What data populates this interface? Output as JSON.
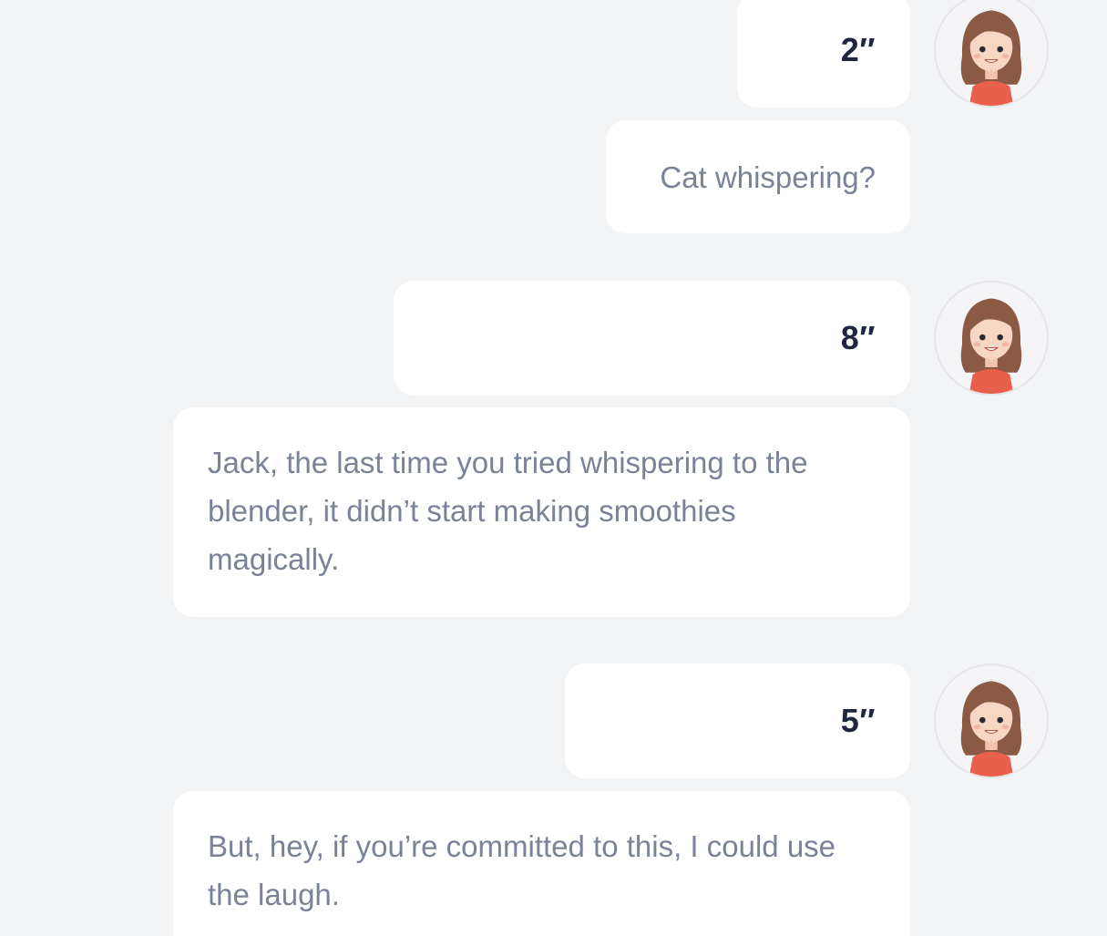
{
  "messages": [
    {
      "type": "voice",
      "duration": "2″",
      "avatar": "woman-avatar"
    },
    {
      "type": "text",
      "text": "Cat whispering?"
    },
    {
      "type": "voice",
      "duration": "8″",
      "avatar": "woman-avatar"
    },
    {
      "type": "text",
      "text": "Jack, the last time you tried whispering to the blender, it didn’t start making smoothies magically."
    },
    {
      "type": "voice",
      "duration": "5″",
      "avatar": "woman-avatar"
    },
    {
      "type": "text",
      "text": "But, hey, if you’re committed to this, I could use the laugh."
    }
  ],
  "colors": {
    "background": "#f2f3f5",
    "bubble": "#ffffff",
    "duration_text": "#1f2640",
    "message_text": "#7a8297"
  }
}
